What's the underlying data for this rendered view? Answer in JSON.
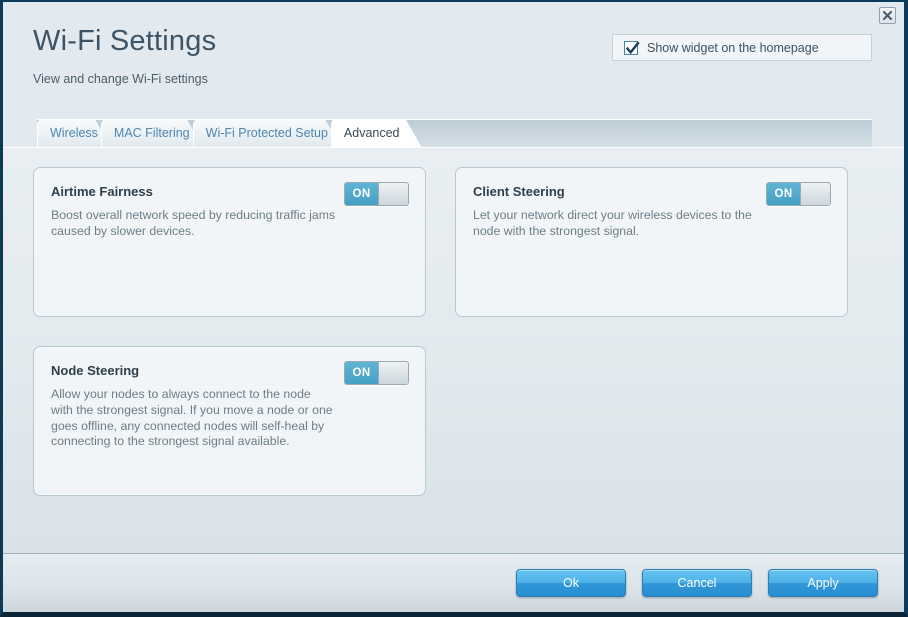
{
  "window": {
    "close_icon": "close-icon"
  },
  "header": {
    "title": "Wi-Fi Settings",
    "subtitle": "View and change Wi-Fi settings",
    "widget_checkbox": {
      "label": "Show widget on the homepage",
      "checked": true
    }
  },
  "tabs": [
    {
      "label": "Wireless",
      "active": false
    },
    {
      "label": "MAC Filtering",
      "active": false
    },
    {
      "label": "Wi-Fi Protected Setup",
      "active": false
    },
    {
      "label": "Advanced",
      "active": true
    }
  ],
  "cards": [
    {
      "title": "Airtime Fairness",
      "description": "Boost overall network speed by reducing traffic jams caused by slower devices.",
      "toggle_state": "ON"
    },
    {
      "title": "Client Steering",
      "description": "Let your network direct your wireless devices to the node with the strongest signal.",
      "toggle_state": "ON"
    },
    {
      "title": "Node Steering",
      "description": "Allow your nodes to always connect to the node with the strongest signal. If you move a node or one goes offline, any connected nodes will self-heal by connecting to the strongest signal available.",
      "toggle_state": "ON"
    }
  ],
  "footer": {
    "buttons": [
      {
        "label": "Ok"
      },
      {
        "label": "Cancel"
      },
      {
        "label": "Apply"
      }
    ]
  },
  "colors": {
    "accent_blue": "#4fb2e8",
    "toggle_on_blue": "#45a0c4",
    "title_text": "#3d5466",
    "tab_link": "#4b86b4",
    "window_border": "#0b3a5c"
  }
}
